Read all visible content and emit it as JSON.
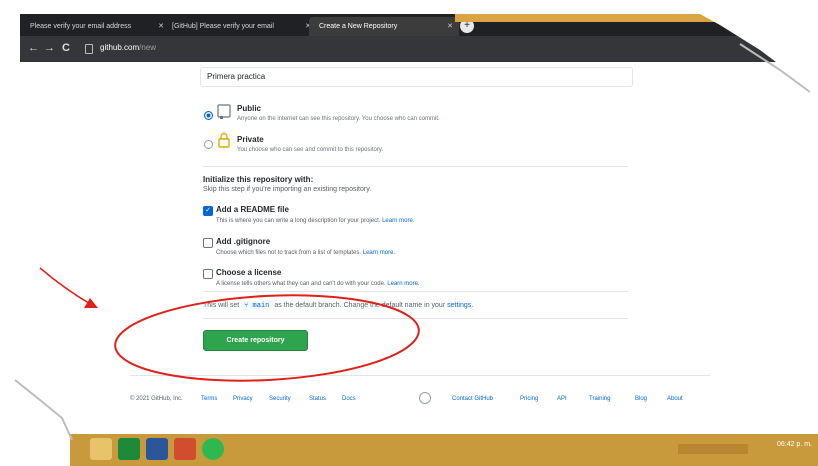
{
  "browser": {
    "tabs": [
      {
        "label": "Please verify your email address",
        "close": "✕"
      },
      {
        "label": "[GitHub] Please verify your email",
        "close": "✕"
      },
      {
        "label": "Create a New Repository",
        "close": "✕"
      }
    ],
    "new_tab": "+",
    "back": "←",
    "forward": "→",
    "reload": "C",
    "url_host": "github.com",
    "url_path": "/new",
    "bookmark": "☆"
  },
  "form": {
    "repo_name_value": "Primera practica",
    "visibility": [
      {
        "title": "Public",
        "desc": "Anyone on the internet can see this repository. You choose who can commit.",
        "selected": true
      },
      {
        "title": "Private",
        "desc": "You choose who can see and commit to this repository.",
        "selected": false
      }
    ],
    "init_heading": "Initialize this repository with:",
    "init_sub": "Skip this step if you're importing an existing repository.",
    "options": [
      {
        "title": "Add a README file",
        "desc": "This is where you can write a long description for your project.",
        "link": "Learn more.",
        "checked": true
      },
      {
        "title": "Add .gitignore",
        "desc": "Choose which files not to track from a list of templates.",
        "link": "Learn more.",
        "checked": false
      },
      {
        "title": "Choose a license",
        "desc": "A license tells others what they can and can't do with your code.",
        "link": "Learn more.",
        "checked": false
      }
    ],
    "branch_prefix": "This will set",
    "branch_name": "main",
    "branch_middle": "as the default branch. Change the default name in your",
    "branch_link": "settings.",
    "create_button": "Create repository"
  },
  "footer": {
    "copyright": "© 2021 GitHub, Inc.",
    "links_left": [
      "Terms",
      "Privacy",
      "Security",
      "Status",
      "Docs"
    ],
    "links_right": [
      "Contact GitHub",
      "Pricing",
      "API",
      "Training",
      "Blog",
      "About"
    ]
  },
  "taskbar": {
    "clock": "06:42 p. m."
  },
  "colors": {
    "annotation_red": "#e0201a",
    "primary_green": "#2ea44f",
    "link_blue": "#0366d6"
  }
}
